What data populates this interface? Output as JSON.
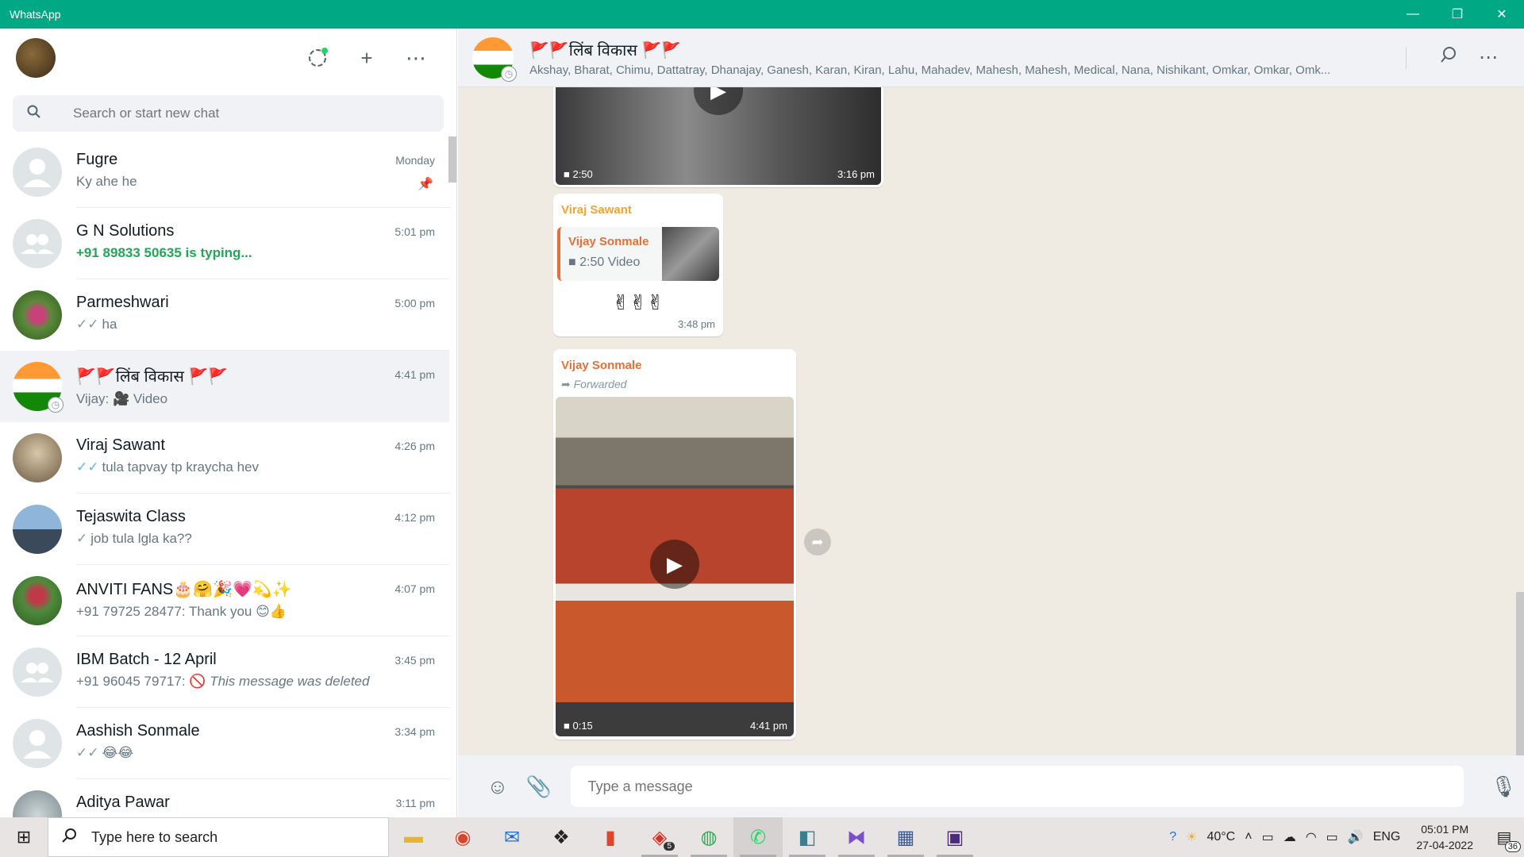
{
  "window": {
    "title": "WhatsApp",
    "minimize": "—",
    "maximize": "❐",
    "close": "✕"
  },
  "left_header": {
    "status_icon": "status-icon",
    "new_chat_icon": "+",
    "menu_icon": "⋯"
  },
  "search": {
    "placeholder": "Search or start new chat"
  },
  "chats": [
    {
      "name": "Fugre",
      "time": "Monday",
      "message": "Ky ahe he",
      "pinned": true
    },
    {
      "name": "G N Solutions",
      "time": "5:01 pm",
      "message": "+91 89833 50635 is typing...",
      "typing": true
    },
    {
      "name": "Parmeshwari",
      "time": "5:00 pm",
      "tick": "✓✓",
      "message": "ha"
    },
    {
      "name": "🚩🚩लिंब विकास 🚩🚩",
      "time": "4:41 pm",
      "message_prefix": "Vijay: ",
      "media_icon": "🎥",
      "message": " Video"
    },
    {
      "name": "Viraj Sawant",
      "time": "4:26 pm",
      "tick": "✓✓",
      "message": "tula tapvay tp kraycha hev"
    },
    {
      "name": "Tejaswita Class",
      "time": "4:12 pm",
      "tick": "✓",
      "message": "job tula lgla ka??"
    },
    {
      "name": "ANVITI FANS🎂🤗🎉💗💫✨",
      "time": "4:07 pm",
      "message": "+91 79725 28477: Thank you 😊👍"
    },
    {
      "name": "IBM Batch - 12 April",
      "time": "3:45 pm",
      "message_prefix": "+91 96045 79717: ",
      "deleted_icon": "🚫",
      "message": "This message was deleted"
    },
    {
      "name": "Aashish Sonmale",
      "time": "3:34 pm",
      "tick": "✓✓",
      "message": "😂😂"
    },
    {
      "name": "Aditya Pawar",
      "time": "3:11 pm",
      "message": ""
    }
  ],
  "conversation": {
    "title": "🚩🚩लिंब विकास 🚩🚩",
    "members": "Akshay, Bharat, Chimu, Dattatray, Dhanajay, Ganesh, Karan, Kiran, Lahu, Mahadev, Mahesh, Mahesh, Medical, Nana, Nishikant, Omkar, Omkar, Omk...",
    "messages": [
      {
        "duration": "2:50",
        "time": "3:16 pm"
      },
      {
        "sender": "Viraj Sawant",
        "quoted_sender": "Vijay Sonmale",
        "quoted_text": "2:50 Video",
        "text": "✌✌✌",
        "time": "3:48 pm"
      },
      {
        "sender": "Vijay Sonmale",
        "forwarded": "Forwarded",
        "duration": "0:15",
        "time": "4:41 pm"
      }
    ]
  },
  "composer": {
    "placeholder": "Type a message"
  },
  "taskbar": {
    "search_label": "Type here to search",
    "badge_count": "5",
    "weather": "40°C",
    "language": "ENG",
    "time": "05:01 PM",
    "date": "27-04-2022",
    "notifications": "36"
  },
  "colors": {
    "accent": "#00a884",
    "chat_bg": "#efeae2",
    "sender_orange": "#e4703a",
    "sender_yellow": "#f0a532"
  }
}
